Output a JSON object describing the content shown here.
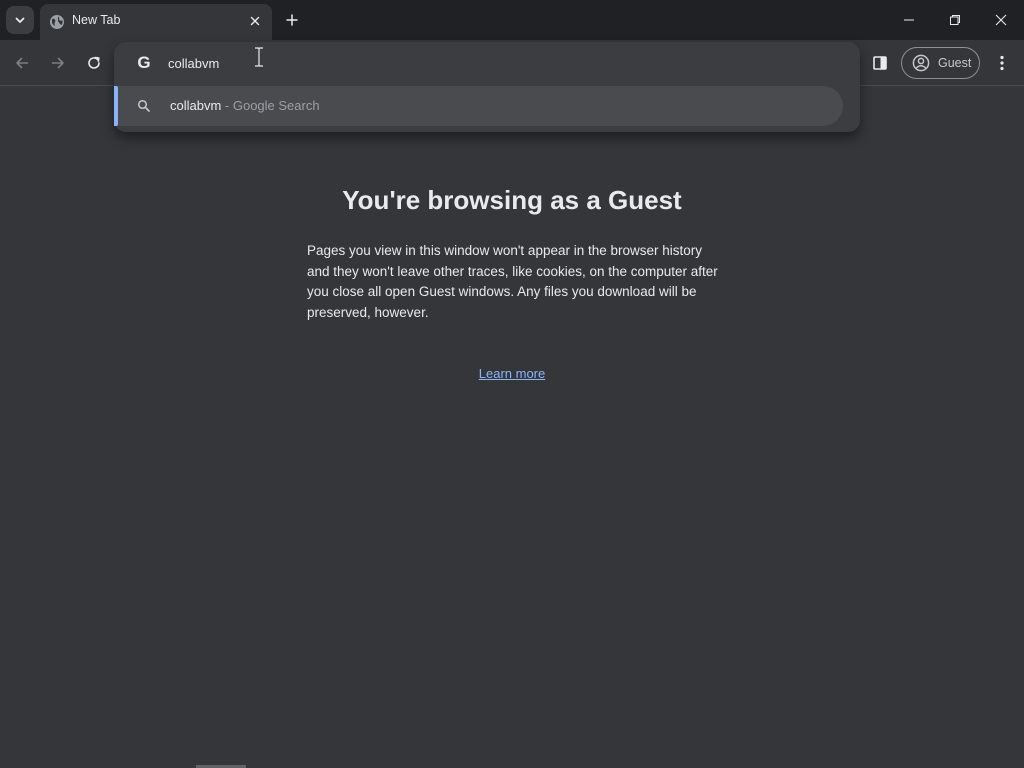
{
  "tab": {
    "title": "New Tab"
  },
  "omnibox": {
    "value": "collabvm",
    "suggestion": {
      "query": "collabvm",
      "suffix": " - Google Search"
    }
  },
  "profile": {
    "label": "Guest"
  },
  "page": {
    "title": "You're browsing as a Guest",
    "description": "Pages you view in this window won't appear in the browser history and they won't leave other traces, like cookies, on the computer after you close all open Guest windows. Any files you download will be preserved, however.",
    "learn_more": "Learn more"
  },
  "colors": {
    "background": "#35363a",
    "titlebar": "#202124",
    "link": "#8ab4f8",
    "suggestion_highlight": "#4a4b4f"
  },
  "icons": {
    "tab_search": "chevron-down-icon",
    "favicon": "globe-icon",
    "tab_close": "close-icon",
    "new_tab": "plus-icon",
    "back": "arrow-left-icon",
    "forward": "arrow-right-icon",
    "reload": "reload-icon",
    "side_panel": "side-panel-icon",
    "avatar": "account-circle-icon",
    "menu": "more-vertical-icon",
    "search": "search-icon",
    "google": "google-icon"
  }
}
